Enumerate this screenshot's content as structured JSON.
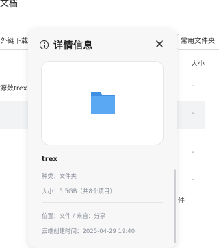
{
  "background": {
    "title": "文档",
    "left_button": "外链下载",
    "right_button": "常用文件夹",
    "column_header": "大小",
    "rows": [
      {
        "name": "源数trex win",
        "size": "-"
      },
      {
        "name": "",
        "size": "-"
      },
      {
        "name": "",
        "size": "-"
      },
      {
        "name": "",
        "size": "-"
      }
    ],
    "bottom_edge": "件"
  },
  "modal": {
    "title": "详情信息",
    "file": {
      "name": "trex",
      "type": "种类：文件夹",
      "size": "大小：5.5GB（共8个项目）",
      "location": "位置：文件 / 来自：分享",
      "created": "云端创建时间：2025-04-29 19:40"
    }
  },
  "colors": {
    "modal_bg": "#f7f7f8",
    "folder_blue": "#5aa8f4",
    "folder_tab": "#3f8fe4"
  }
}
